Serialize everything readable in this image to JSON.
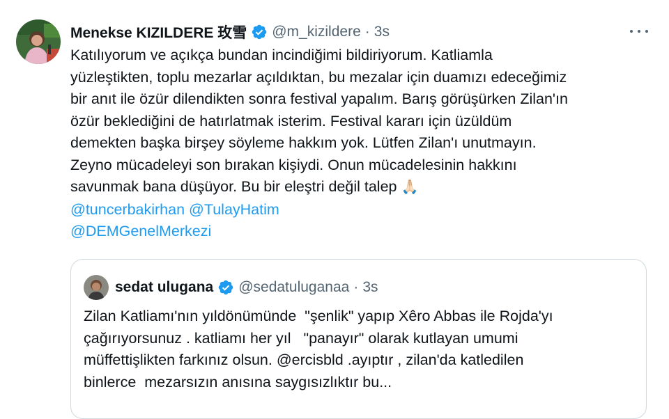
{
  "tweet": {
    "author": {
      "display_name": "Menekse KIZILDERE 玫雪",
      "handle": "@m_kizildere",
      "separator": "·",
      "time": "3s"
    },
    "body_lines": [
      "Katılıyorum ve açıkça bundan incindiğimi bildiriyorum. Katliamla",
      "yüzleştikten, toplu mezarlar açıldıktan, bu mezalar için duamızı edeceğimiz",
      "bir anıt ile özür dilendikten sonra festival yapalım. Barış görüşürken Zilan'ın",
      "özür beklediğini de hatırlatmak isterim. Festival kararı için üzüldüm",
      "demekten başka birşey söyleme hakkım yok. Lütfen Zilan'ı unutmayın.",
      "Zeyno mücadeleyi son bırakan kişiydi. Onun mücadelesinin hakkını",
      "savunmak bana düşüyor. Bu bir eleştri değil talep"
    ],
    "emoji": "🙏🏻",
    "mentions": [
      "@tuncerbakirhan",
      "@TulayHatim",
      "@DEMGenelMerkezi"
    ],
    "quoted": {
      "display_name": "sedat ulugana",
      "handle": "@sedatuluganaa",
      "separator": "·",
      "time": "3s",
      "body_lines": [
        "Zilan Katliamı'nın yıldönümünde  \"şenlik\" yapıp Xêro Abbas ile Rojda'yı",
        "çağırıyorsunuz . katliamı her yıl   \"panayır\" olarak kutlayan umumi",
        "müffettişlikten farkınız olsun. @ercisbld .ayıptır , zilan'da katledilen",
        "binlerce  mezarsızın anısına saygısızlıktır bu..."
      ]
    },
    "colors": {
      "text": "#0f1419",
      "secondary": "#536471",
      "link": "#1d9bf0",
      "verified": "#1d9bf0",
      "border": "#cfd9de"
    },
    "icons": [
      "verified-badge-icon",
      "more-options-icon"
    ]
  }
}
